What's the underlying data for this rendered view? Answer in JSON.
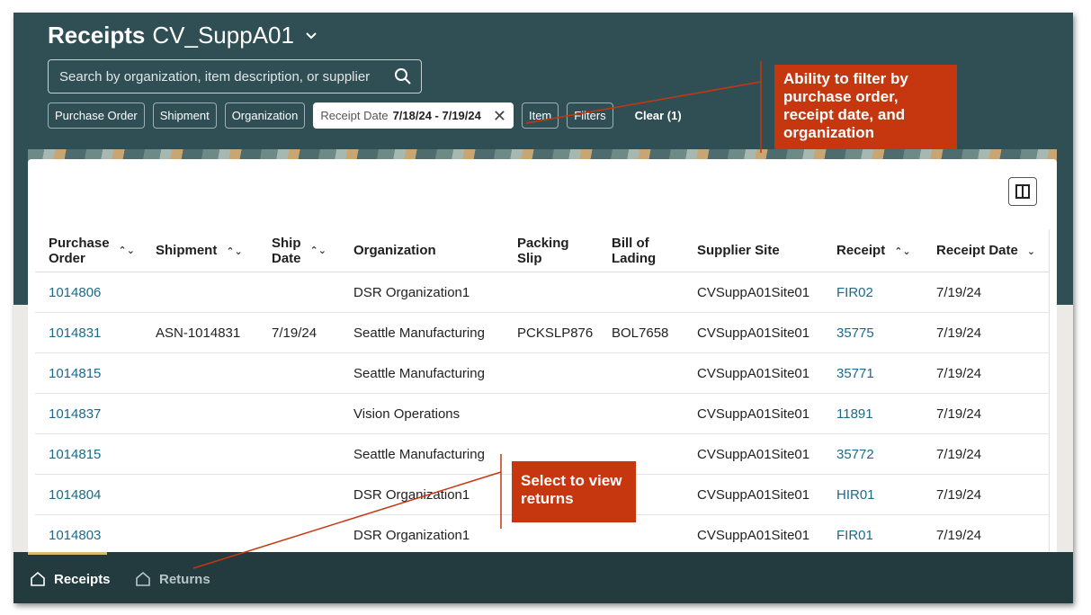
{
  "header": {
    "title_bold": "Receipts",
    "title_supplier": "CV_SuppA01"
  },
  "search": {
    "placeholder": "Search by organization, item description, or supplier"
  },
  "filters": {
    "chips": [
      "Purchase Order",
      "Shipment",
      "Organization"
    ],
    "active_chip": {
      "label": "Receipt Date",
      "value": "7/18/24 - 7/19/24"
    },
    "chips_after": [
      "Item",
      "Filters"
    ],
    "clear_label": "Clear (1)"
  },
  "table": {
    "headers": {
      "purchase_order_l1": "Purchase",
      "purchase_order_l2": "Order",
      "shipment": "Shipment",
      "ship_date_l1": "Ship",
      "ship_date_l2": "Date",
      "organization": "Organization",
      "packing_slip_l1": "Packing",
      "packing_slip_l2": "Slip",
      "bill_of_lading_l1": "Bill of",
      "bill_of_lading_l2": "Lading",
      "supplier_site": "Supplier Site",
      "receipt": "Receipt",
      "receipt_date": "Receipt Date"
    },
    "rows": [
      {
        "po": "1014806",
        "shipment": "",
        "ship_date": "",
        "org": "DSR Organization1",
        "packing_slip": "",
        "bol": "",
        "site": "CVSuppA01Site01",
        "receipt": "FIR02",
        "receipt_date": "7/19/24"
      },
      {
        "po": "1014831",
        "shipment": "ASN-1014831",
        "ship_date": "7/19/24",
        "org": "Seattle Manufacturing",
        "packing_slip": "PCKSLP876",
        "bol": "BOL7658",
        "site": "CVSuppA01Site01",
        "receipt": "35775",
        "receipt_date": "7/19/24"
      },
      {
        "po": "1014815",
        "shipment": "",
        "ship_date": "",
        "org": "Seattle Manufacturing",
        "packing_slip": "",
        "bol": "",
        "site": "CVSuppA01Site01",
        "receipt": "35771",
        "receipt_date": "7/19/24"
      },
      {
        "po": "1014837",
        "shipment": "",
        "ship_date": "",
        "org": "Vision Operations",
        "packing_slip": "",
        "bol": "",
        "site": "CVSuppA01Site01",
        "receipt": "11891",
        "receipt_date": "7/19/24"
      },
      {
        "po": "1014815",
        "shipment": "",
        "ship_date": "",
        "org": "Seattle Manufacturing",
        "packing_slip": "",
        "bol": "",
        "site": "CVSuppA01Site01",
        "receipt": "35772",
        "receipt_date": "7/19/24"
      },
      {
        "po": "1014804",
        "shipment": "",
        "ship_date": "",
        "org": "DSR Organization1",
        "packing_slip": "",
        "bol": "",
        "site": "CVSuppA01Site01",
        "receipt": "HIR01",
        "receipt_date": "7/19/24"
      },
      {
        "po": "1014803",
        "shipment": "",
        "ship_date": "",
        "org": "DSR Organization1",
        "packing_slip": "",
        "bol": "",
        "site": "CVSuppA01Site01",
        "receipt": "FIR01",
        "receipt_date": "7/19/24"
      }
    ]
  },
  "tabs": {
    "receipts": "Receipts",
    "returns": "Returns"
  },
  "callouts": {
    "filter_note": "Ability to filter by purchase order, receipt date, and organization",
    "returns_note": "Select to view returns"
  },
  "colors": {
    "header_bg": "#2f4f54",
    "tabbar_bg": "#233a3f",
    "link": "#1c6a8a",
    "callout": "#c7370f"
  }
}
